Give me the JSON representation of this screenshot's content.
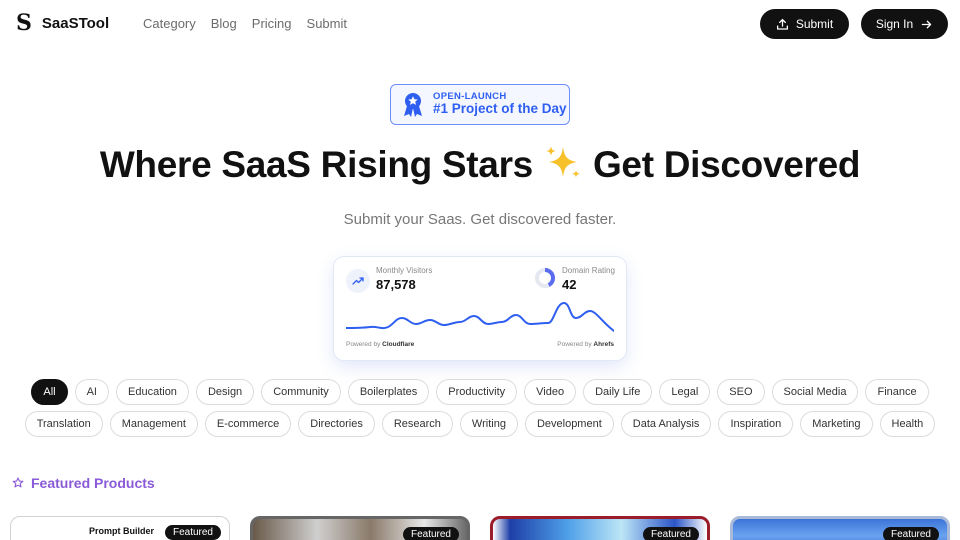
{
  "header": {
    "logo_mark": "S",
    "logo_text": "SaaSTool",
    "nav": [
      "Category",
      "Blog",
      "Pricing",
      "Submit"
    ],
    "submit_label": "Submit",
    "signin_label": "Sign In"
  },
  "badge": {
    "kicker": "OPEN-LAUNCH",
    "main": "#1 Project of the Day"
  },
  "hero": {
    "title_part1": "Where SaaS Rising Stars",
    "title_part2": "Get Discovered",
    "subtitle": "Submit your Saas. Get discovered faster."
  },
  "stats": {
    "visitors_label": "Monthly Visitors",
    "visitors_value": "87,578",
    "rating_label": "Domain Rating",
    "rating_value": "42",
    "rating_fraction": 0.42,
    "powered_left_prefix": "Powered by",
    "powered_left_brand": "Cloudflare",
    "powered_right_prefix": "Powered by",
    "powered_right_brand": "Ahrefs",
    "line_color": "#2f5ff0"
  },
  "chips": {
    "row1": [
      "All",
      "AI",
      "Education",
      "Design",
      "Community",
      "Boilerplates",
      "Productivity",
      "Video",
      "Daily Life",
      "Legal",
      "SEO",
      "Social Media",
      "Finance"
    ],
    "row2": [
      "Translation",
      "Management",
      "E-commerce",
      "Directories",
      "Research",
      "Writing",
      "Development",
      "Data Analysis",
      "Inspiration",
      "Marketing",
      "Health"
    ],
    "active": "All"
  },
  "featured": {
    "title": "Featured Products",
    "color": "#8a5bd8",
    "cards": [
      {
        "tag": "Featured",
        "title": "Prompt Builder"
      },
      {
        "tag": "Featured"
      },
      {
        "tag": "Featured"
      },
      {
        "tag": "Featured"
      }
    ]
  }
}
